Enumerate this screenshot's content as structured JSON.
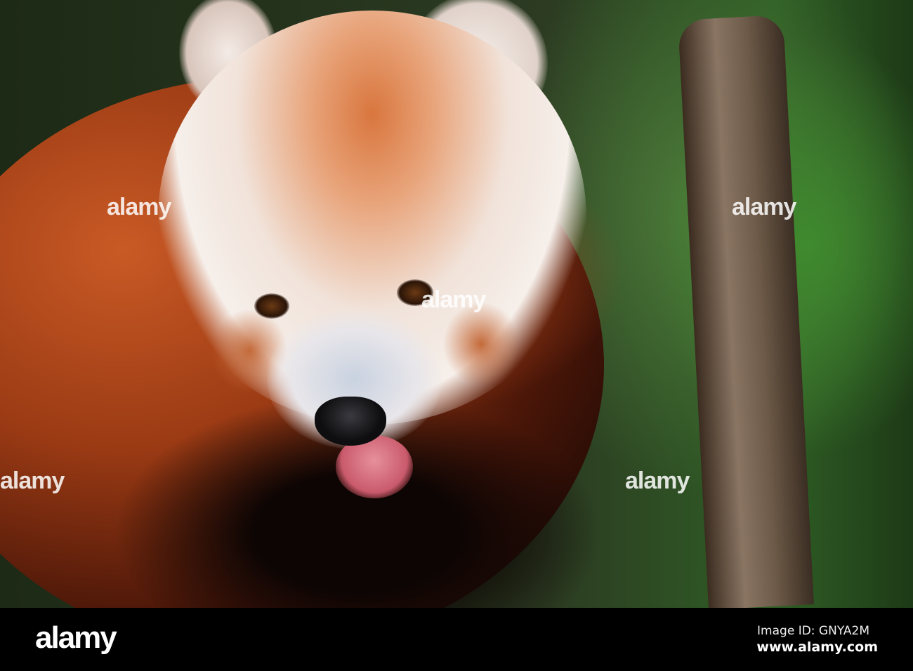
{
  "photo": {
    "subject": "red panda"
  },
  "watermark": {
    "text": "alamy"
  },
  "footer": {
    "logo": "alamy",
    "image_id": "Image ID: GNYA2M",
    "website": "www.alamy.com"
  }
}
